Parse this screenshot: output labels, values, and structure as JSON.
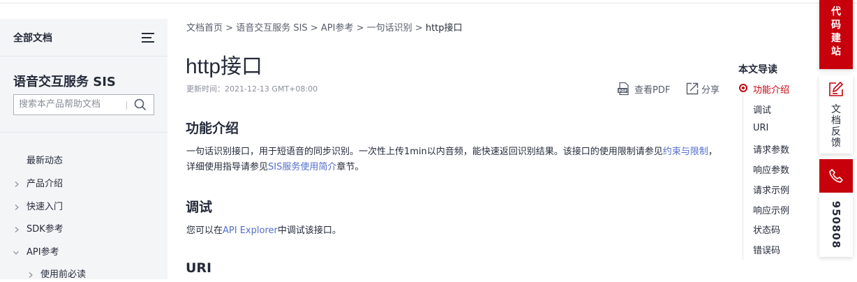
{
  "sidebar": {
    "all_docs": "全部文档",
    "product_title": "语音交互服务 SIS",
    "search_placeholder": "搜索本产品帮助文档",
    "items": [
      {
        "label": "最新动态",
        "chevron": "none"
      },
      {
        "label": "产品介绍",
        "chevron": "right"
      },
      {
        "label": "快速入门",
        "chevron": "right"
      },
      {
        "label": "SDK参考",
        "chevron": "right"
      },
      {
        "label": "API参考",
        "chevron": "down"
      },
      {
        "label": "使用前必读",
        "chevron": "right"
      }
    ]
  },
  "breadcrumb": {
    "items": [
      "文档首页",
      "语音交互服务 SIS",
      "API参考",
      "一句话识别"
    ],
    "separator": ">",
    "current": "http接口"
  },
  "page": {
    "title": "http接口",
    "updated": "更新时间：2021-12-13 GMT+08:00",
    "pdf_label": "查看PDF",
    "share_label": "分享"
  },
  "content": {
    "s1_heading": "功能介绍",
    "s1_text_a": "一句话识别接口，用于短语音的同步识别。一次性上传1min以内音频，能快速返回识别结果。该接口的使用限制请参见",
    "s1_link_a": "约束与限制",
    "s1_text_b": "，详细使用指导请参见",
    "s1_link_b": "SIS服务使用简介",
    "s1_text_c": "章节。",
    "s2_heading": "调试",
    "s2_text_a": "您可以在",
    "s2_link": "API Explorer",
    "s2_text_b": "中调试该接口。",
    "s3_heading": "URI"
  },
  "toc": {
    "title": "本文导读",
    "items": [
      "功能介绍",
      "调试",
      "URI",
      "请求参数",
      "响应参数",
      "请求示例",
      "响应示例",
      "状态码",
      "错误码"
    ],
    "active_index": 0
  },
  "float": {
    "code_site": "代码建站",
    "feedback": "文档反馈",
    "hotline": "950808"
  },
  "colors": {
    "accent": "#c7000b",
    "link": "#526ecc",
    "sidebar_bg": "#f4f5f7"
  }
}
